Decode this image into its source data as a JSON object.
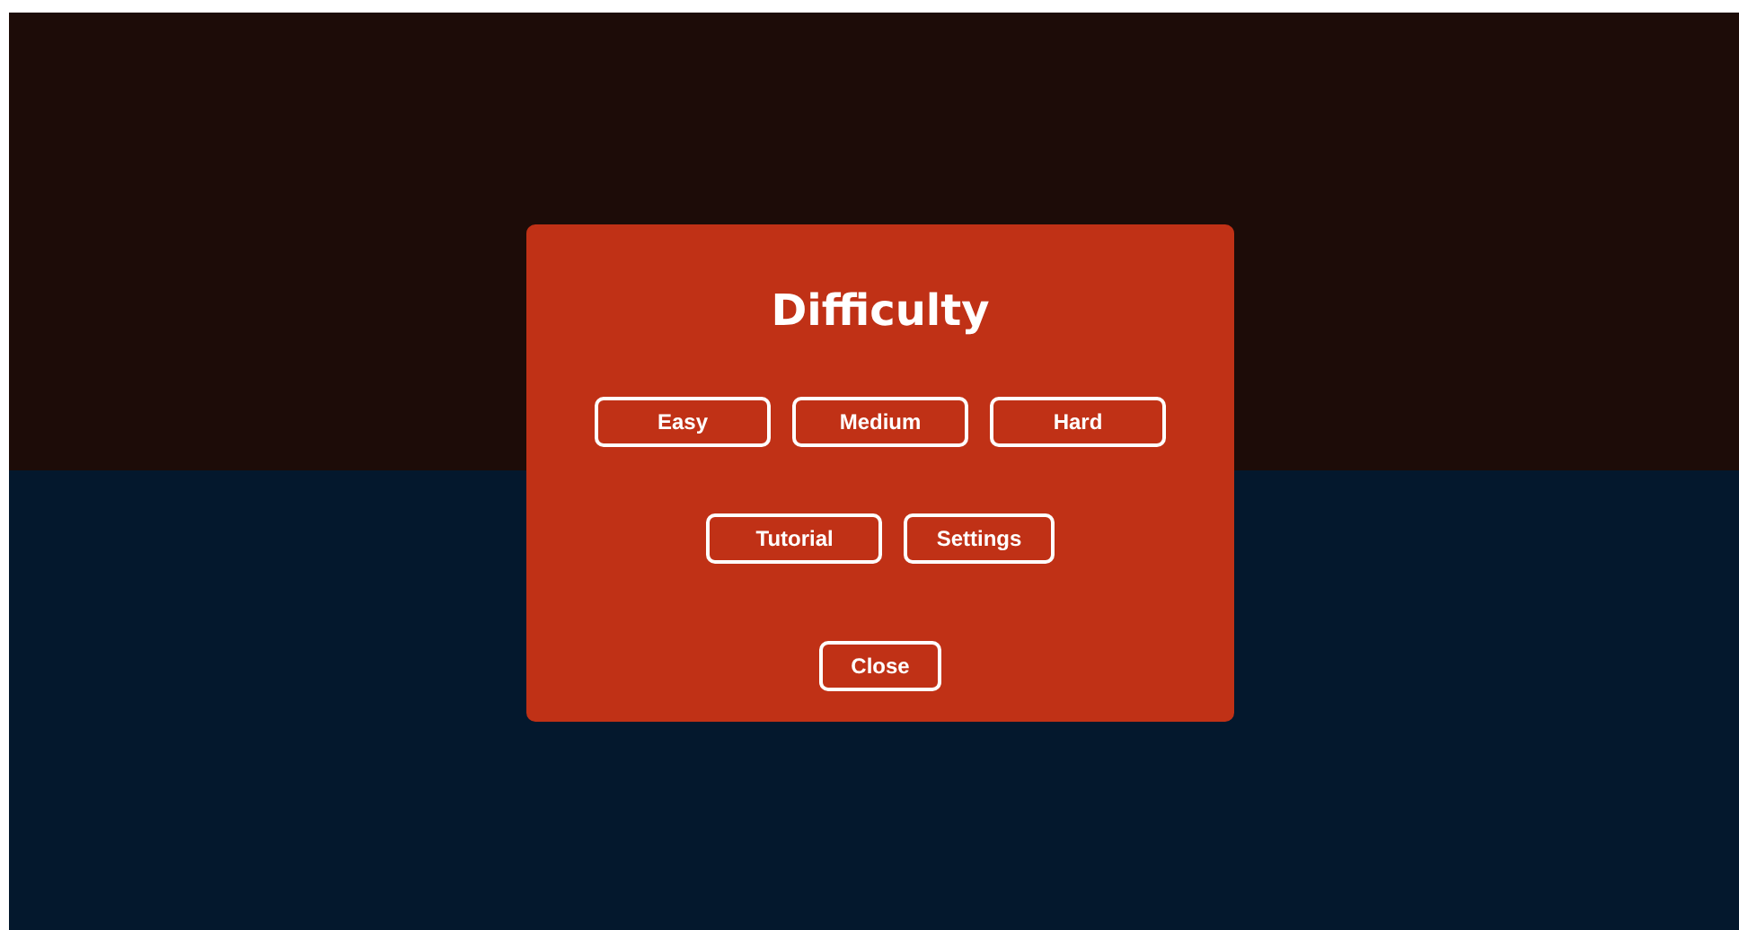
{
  "dialog": {
    "title": "Difficulty",
    "button_rows": [
      [
        "Easy",
        "Medium",
        "Hard"
      ],
      [
        "Tutorial",
        "Settings"
      ],
      [
        "Close"
      ]
    ]
  }
}
